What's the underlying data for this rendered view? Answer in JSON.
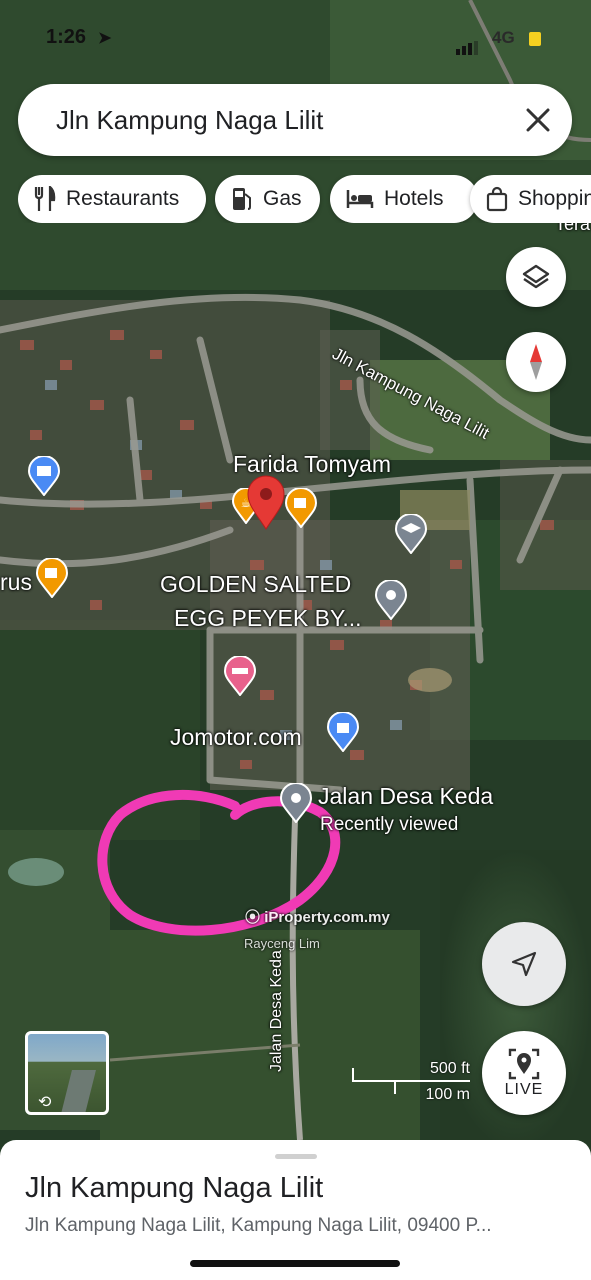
{
  "status_bar": {
    "time": "1:26",
    "network": "4G"
  },
  "search": {
    "query": "Jln Kampung Naga Lilit"
  },
  "chips": [
    {
      "icon": "fork-knife-icon",
      "label": "Restaurants"
    },
    {
      "icon": "gas-pump-icon",
      "label": "Gas"
    },
    {
      "icon": "bed-icon",
      "label": "Hotels"
    },
    {
      "icon": "shopping-bag-icon",
      "label": "Shoppin"
    }
  ],
  "map": {
    "road_labels": {
      "kampung": "Jln Kampung Naga Lilit",
      "desa_keda": "Jalan Desa Keda",
      "partial_top_right": "Tera"
    },
    "places": {
      "farida": "Farida Tomyam",
      "golden_line1": "GOLDEN SALTED",
      "golden_line2": "EGG PEYEK BY...",
      "jomotor": "Jomotor.com",
      "desa_keda_pin": "Jalan Desa Keda",
      "desa_keda_sub": "Recently viewed",
      "partial_left": "rus"
    },
    "watermark": "iProperty.com.my",
    "watermark_sub": "Rayceng Lim",
    "scale": {
      "feet": "500 ft",
      "meters": "100 m"
    },
    "annotation_color": "#f03ab5"
  },
  "buttons": {
    "live": "LIVE"
  },
  "sheet": {
    "title": "Jln Kampung Naga Lilit",
    "address": "Jln Kampung Naga Lilit, Kampung Naga Lilit, 09400 P..."
  }
}
